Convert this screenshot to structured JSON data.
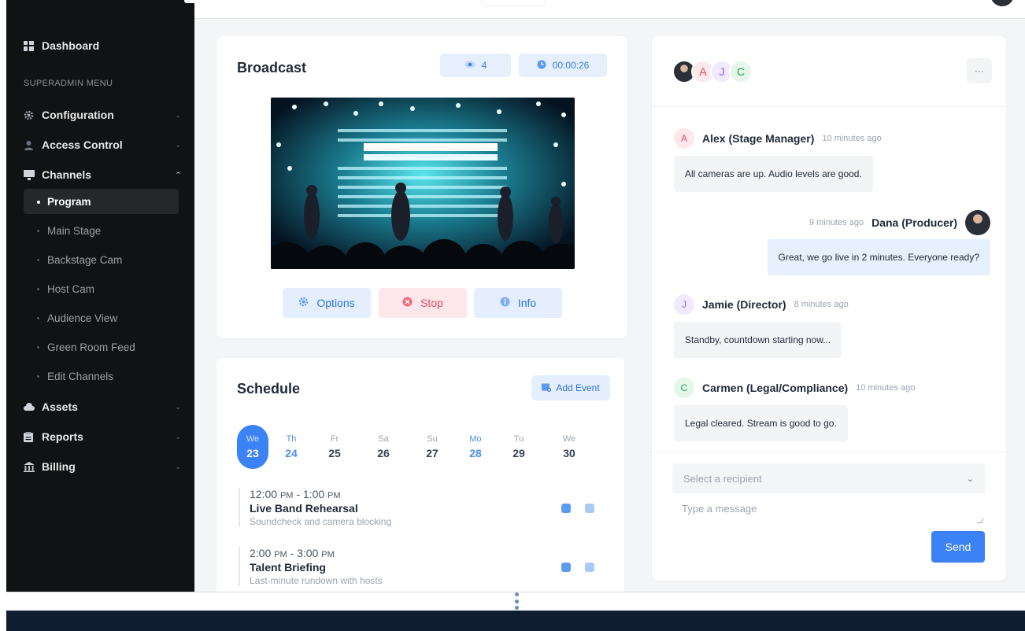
{
  "sidebar": {
    "dashboard": "Dashboard",
    "heading": "SUPERADMIN MENU",
    "configuration": "Configuration",
    "access_control": "Access Control",
    "channels": "Channels",
    "channel_items": [
      "Program",
      "Main Stage",
      "Backstage Cam",
      "Host Cam",
      "Audience View",
      "Green Room Feed",
      "Edit Channels"
    ],
    "assets": "Assets",
    "reports": "Reports",
    "billing": "Billing"
  },
  "broadcast": {
    "title": "Broadcast",
    "viewers": "4",
    "timer": "00:00:26",
    "options_label": "Options",
    "stop_label": "Stop",
    "info_label": "Info"
  },
  "schedule": {
    "title": "Schedule",
    "add_event_label": "Add Event",
    "days": [
      {
        "name": "We",
        "date": "23"
      },
      {
        "name": "Th",
        "date": "24"
      },
      {
        "name": "Fr",
        "date": "25"
      },
      {
        "name": "Sa",
        "date": "26"
      },
      {
        "name": "Su",
        "date": "27"
      },
      {
        "name": "Mo",
        "date": "28"
      },
      {
        "name": "Tu",
        "date": "29"
      },
      {
        "name": "We",
        "date": "30"
      }
    ],
    "events": [
      {
        "start": "12:00",
        "start_ap": "PM",
        "end": "1:00",
        "end_ap": "PM",
        "title": "Live Band Rehearsal",
        "desc": "Soundcheck and camera blocking"
      },
      {
        "start": "2:00",
        "start_ap": "PM",
        "end": "3:00",
        "end_ap": "PM",
        "title": "Talent Briefing",
        "desc": "Last-minute rundown with hosts"
      }
    ]
  },
  "chat": {
    "participants": [
      "A",
      "J",
      "C"
    ],
    "more_label": "···",
    "messages": [
      {
        "initial": "A",
        "name": "Alex (Stage Manager)",
        "time": "10 minutes ago",
        "text": "All cameras are up. Audio levels are good."
      },
      {
        "name": "Dana (Producer)",
        "time": "9 minutes ago",
        "text": "Great, we go live in 2 minutes. Everyone ready?"
      },
      {
        "initial": "J",
        "name": "Jamie (Director)",
        "time": "8 minutes ago",
        "text": "Standby, countdown starting now..."
      },
      {
        "initial": "C",
        "name": "Carmen (Legal/Compliance)",
        "time": "10 minutes ago",
        "text": "Legal cleared. Stream is good to go."
      }
    ],
    "recipient_placeholder": "Select a recipient",
    "message_placeholder": "Type a message",
    "send_label": "Send"
  },
  "colors": {
    "accent": "#3b82f6",
    "sidebar_bg": "#111213",
    "danger": "#e5485d",
    "bottom_bar": "#0f1d33"
  }
}
